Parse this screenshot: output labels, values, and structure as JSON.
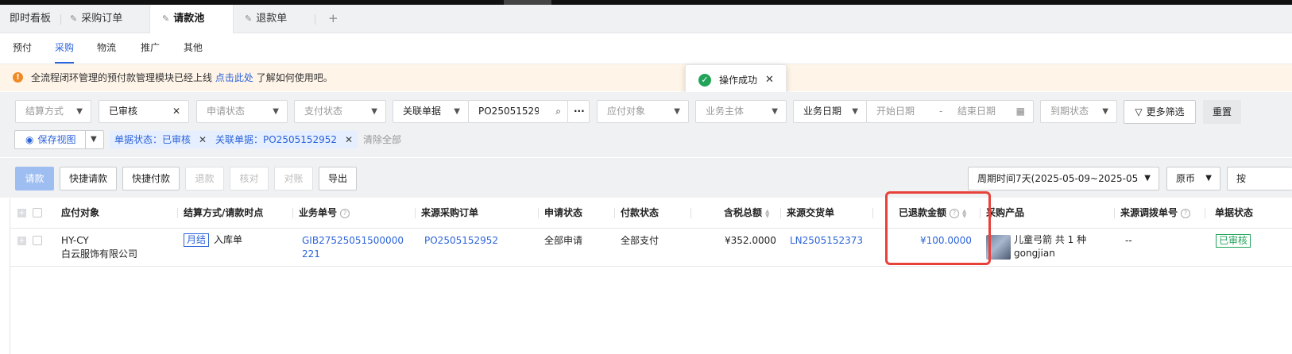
{
  "tabs": [
    {
      "label": "即时看板",
      "pinned": false,
      "active": false
    },
    {
      "label": "采购订单",
      "pinned": true,
      "active": false
    },
    {
      "label": "请款池",
      "pinned": true,
      "active": true
    },
    {
      "label": "退款单",
      "pinned": true,
      "active": false
    }
  ],
  "tab_add": "+",
  "subnav": [
    "预付",
    "采购",
    "物流",
    "推广",
    "其他"
  ],
  "subnav_active": "采购",
  "notice": {
    "icon": "!",
    "text": "全流程闭环管理的预付款管理模块已经上线",
    "link": "点击此处",
    "suffix": "了解如何使用吧。"
  },
  "toast": {
    "message": "操作成功",
    "close": "✕"
  },
  "filters": {
    "settlement": "结算方式",
    "doc_status": "已审核",
    "apply_status": "申请状态",
    "pay_status": "支付状态",
    "related_label": "关联单据",
    "related_value": "PO2505152952",
    "payee": "应付对象",
    "entity": "业务主体",
    "date_type": "业务日期",
    "start_date": "开始日期",
    "date_sep": "-",
    "end_date": "结束日期",
    "due_status": "到期状态",
    "more": "更多筛选",
    "reset": "重置"
  },
  "view": {
    "save_view": "保存视图"
  },
  "chips": [
    {
      "label": "单据状态：已审核"
    },
    {
      "label": "关联单据：PO2505152952"
    }
  ],
  "clear_all": "清除全部",
  "actions": {
    "request": "请款",
    "quick_request": "快捷请款",
    "quick_pay": "快捷付款",
    "refund": "退款",
    "verify": "核对",
    "reconcile": "对账",
    "export": "导出"
  },
  "period": "周期时间7天(2025-05-09~2025-05",
  "currency": "原币",
  "more_right": "按",
  "columns": [
    "应付对象",
    "结算方式/请款时点",
    "业务单号",
    "来源采购订单",
    "申请状态",
    "付款状态",
    "含税总额",
    "来源交货单",
    "已退款金额",
    "采购产品",
    "来源调拨单号",
    "单据状态"
  ],
  "rows": [
    {
      "payee_code": "HY-CY",
      "payee_name": "白云服饰有限公司",
      "settle_tag": "月结",
      "settle_point": "入库单",
      "biz_no_1": "GIB27525051500000",
      "biz_no_2": "221",
      "source_po": "PO2505152952",
      "apply_status": "全部申请",
      "pay_status": "全部支付",
      "total": "¥352.0000",
      "source_delivery": "LN2505152373",
      "refunded": "¥100.0000",
      "product_line1": "儿童弓箭 共 1 种",
      "product_line2": "gongjian",
      "transfer_no": "--",
      "doc_status": "已审核"
    }
  ],
  "colors": {
    "accent": "#2b63d9",
    "success": "#21a35a",
    "warning": "#f08a24",
    "highlight": "#e8413a"
  }
}
